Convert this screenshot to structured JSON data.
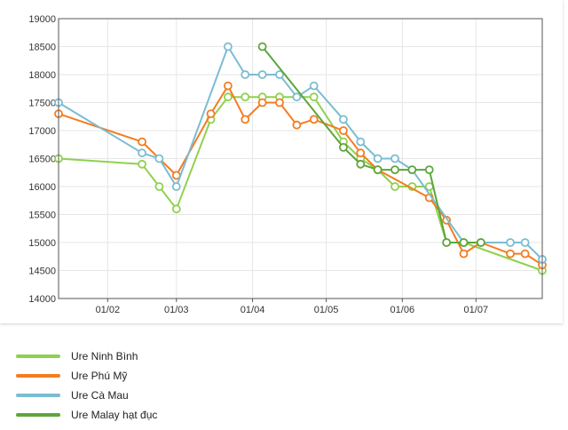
{
  "chart_data": {
    "type": "line",
    "title": "",
    "xlabel": "",
    "ylabel": "",
    "ylim": [
      14000,
      19000
    ],
    "y_ticks": [
      14000,
      14500,
      15000,
      15500,
      16000,
      16500,
      17000,
      17500,
      18000,
      18500,
      19000
    ],
    "x_range": [
      "2021-01-12",
      "2021-07-28"
    ],
    "x_ticks": [
      {
        "date": "2021-02-01",
        "label": "01/02"
      },
      {
        "date": "2021-03-01",
        "label": "01/03"
      },
      {
        "date": "2021-04-01",
        "label": "01/04"
      },
      {
        "date": "2021-05-01",
        "label": "01/05"
      },
      {
        "date": "2021-06-01",
        "label": "01/06"
      },
      {
        "date": "2021-07-01",
        "label": "01/07"
      }
    ],
    "grid": true,
    "legend_position": "bottom",
    "series": [
      {
        "name": "Ure Ninh Bình",
        "color": "#8fd14f",
        "points": [
          [
            "2021-01-12",
            16500
          ],
          [
            "2021-02-15",
            16400
          ],
          [
            "2021-02-22",
            16000
          ],
          [
            "2021-03-01",
            15600
          ],
          [
            "2021-03-15",
            17200
          ],
          [
            "2021-03-22",
            17600
          ],
          [
            "2021-03-29",
            17600
          ],
          [
            "2021-04-05",
            17600
          ],
          [
            "2021-04-12",
            17600
          ],
          [
            "2021-04-26",
            17600
          ],
          [
            "2021-05-08",
            16800
          ],
          [
            "2021-05-15",
            16500
          ],
          [
            "2021-05-22",
            16300
          ],
          [
            "2021-05-29",
            16000
          ],
          [
            "2021-06-05",
            16000
          ],
          [
            "2021-06-12",
            16000
          ],
          [
            "2021-06-19",
            15000
          ],
          [
            "2021-06-26",
            15000
          ],
          [
            "2021-07-28",
            14500
          ]
        ]
      },
      {
        "name": "Ure Phú Mỹ",
        "color": "#f47c20",
        "points": [
          [
            "2021-01-12",
            17300
          ],
          [
            "2021-02-15",
            16800
          ],
          [
            "2021-03-01",
            16200
          ],
          [
            "2021-03-15",
            17300
          ],
          [
            "2021-03-22",
            17800
          ],
          [
            "2021-03-29",
            17200
          ],
          [
            "2021-04-05",
            17500
          ],
          [
            "2021-04-12",
            17500
          ],
          [
            "2021-04-19",
            17100
          ],
          [
            "2021-04-26",
            17200
          ],
          [
            "2021-05-08",
            17000
          ],
          [
            "2021-05-15",
            16600
          ],
          [
            "2021-05-22",
            16300
          ],
          [
            "2021-06-12",
            15800
          ],
          [
            "2021-06-19",
            15400
          ],
          [
            "2021-06-26",
            14800
          ],
          [
            "2021-07-03",
            15000
          ],
          [
            "2021-07-15",
            14800
          ],
          [
            "2021-07-21",
            14800
          ],
          [
            "2021-07-28",
            14600
          ]
        ]
      },
      {
        "name": "Ure Cà Mau",
        "color": "#7bbcd2",
        "points": [
          [
            "2021-01-12",
            17500
          ],
          [
            "2021-02-15",
            16600
          ],
          [
            "2021-02-22",
            16500
          ],
          [
            "2021-03-01",
            16000
          ],
          [
            "2021-03-22",
            18500
          ],
          [
            "2021-03-29",
            18000
          ],
          [
            "2021-04-05",
            18000
          ],
          [
            "2021-04-12",
            18000
          ],
          [
            "2021-04-19",
            17600
          ],
          [
            "2021-04-26",
            17800
          ],
          [
            "2021-05-08",
            17200
          ],
          [
            "2021-05-15",
            16800
          ],
          [
            "2021-05-22",
            16500
          ],
          [
            "2021-05-29",
            16500
          ],
          [
            "2021-06-05",
            16300
          ],
          [
            "2021-06-26",
            15000
          ],
          [
            "2021-07-03",
            15000
          ],
          [
            "2021-07-15",
            15000
          ],
          [
            "2021-07-21",
            15000
          ],
          [
            "2021-07-28",
            14700
          ]
        ]
      },
      {
        "name": "Ure Malay hạt đục",
        "color": "#5ea53a",
        "points": [
          [
            "2021-04-05",
            18500
          ],
          [
            "2021-05-08",
            16700
          ],
          [
            "2021-05-15",
            16400
          ],
          [
            "2021-05-22",
            16300
          ],
          [
            "2021-05-29",
            16300
          ],
          [
            "2021-06-05",
            16300
          ],
          [
            "2021-06-12",
            16300
          ],
          [
            "2021-06-19",
            15000
          ],
          [
            "2021-06-26",
            15000
          ],
          [
            "2021-07-03",
            15000
          ]
        ]
      }
    ]
  }
}
